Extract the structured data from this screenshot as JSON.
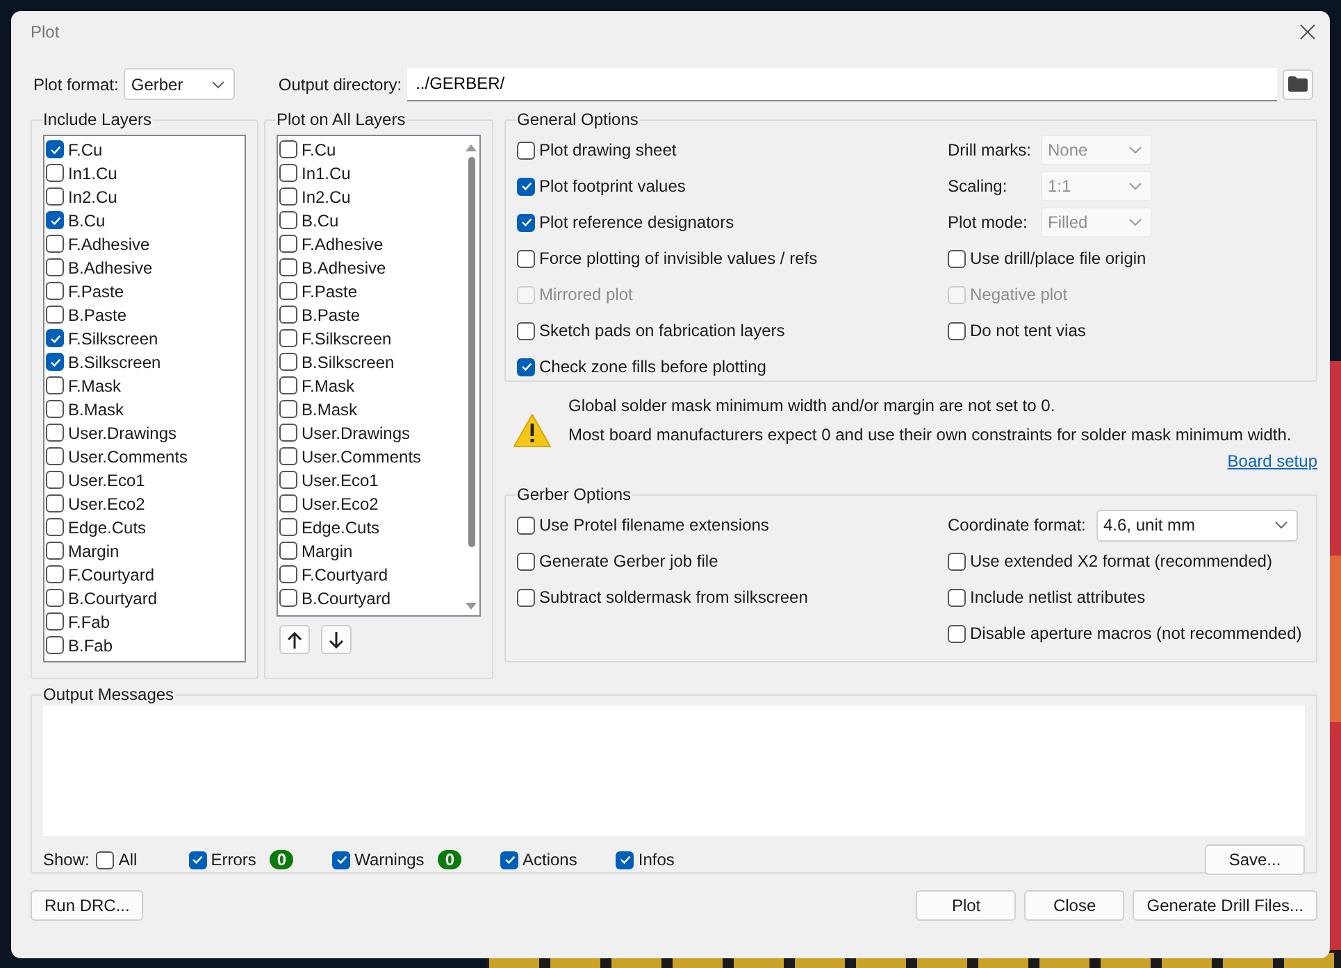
{
  "window": {
    "title": "Plot"
  },
  "plot_format": {
    "label": "Plot format:",
    "value": "Gerber"
  },
  "output_directory": {
    "label": "Output directory:",
    "value": "../GERBER/"
  },
  "include_layers": {
    "title": "Include Layers",
    "items": [
      {
        "label": "F.Cu",
        "checked": true
      },
      {
        "label": "In1.Cu",
        "checked": false
      },
      {
        "label": "In2.Cu",
        "checked": false
      },
      {
        "label": "B.Cu",
        "checked": true
      },
      {
        "label": "F.Adhesive",
        "checked": false
      },
      {
        "label": "B.Adhesive",
        "checked": false
      },
      {
        "label": "F.Paste",
        "checked": false
      },
      {
        "label": "B.Paste",
        "checked": false
      },
      {
        "label": "F.Silkscreen",
        "checked": true
      },
      {
        "label": "B.Silkscreen",
        "checked": true
      },
      {
        "label": "F.Mask",
        "checked": false
      },
      {
        "label": "B.Mask",
        "checked": false
      },
      {
        "label": "User.Drawings",
        "checked": false
      },
      {
        "label": "User.Comments",
        "checked": false
      },
      {
        "label": "User.Eco1",
        "checked": false
      },
      {
        "label": "User.Eco2",
        "checked": false
      },
      {
        "label": "Edge.Cuts",
        "checked": false
      },
      {
        "label": "Margin",
        "checked": false
      },
      {
        "label": "F.Courtyard",
        "checked": false
      },
      {
        "label": "B.Courtyard",
        "checked": false
      },
      {
        "label": "F.Fab",
        "checked": false
      },
      {
        "label": "B.Fab",
        "checked": false
      }
    ]
  },
  "plot_on_all_layers": {
    "title": "Plot on All Layers",
    "items": [
      {
        "label": "F.Cu",
        "checked": false
      },
      {
        "label": "In1.Cu",
        "checked": false
      },
      {
        "label": "In2.Cu",
        "checked": false
      },
      {
        "label": "B.Cu",
        "checked": false
      },
      {
        "label": "F.Adhesive",
        "checked": false
      },
      {
        "label": "B.Adhesive",
        "checked": false
      },
      {
        "label": "F.Paste",
        "checked": false
      },
      {
        "label": "B.Paste",
        "checked": false
      },
      {
        "label": "F.Silkscreen",
        "checked": false
      },
      {
        "label": "B.Silkscreen",
        "checked": false
      },
      {
        "label": "F.Mask",
        "checked": false
      },
      {
        "label": "B.Mask",
        "checked": false
      },
      {
        "label": "User.Drawings",
        "checked": false
      },
      {
        "label": "User.Comments",
        "checked": false
      },
      {
        "label": "User.Eco1",
        "checked": false
      },
      {
        "label": "User.Eco2",
        "checked": false
      },
      {
        "label": "Edge.Cuts",
        "checked": false
      },
      {
        "label": "Margin",
        "checked": false
      },
      {
        "label": "F.Courtyard",
        "checked": false
      },
      {
        "label": "B.Courtyard",
        "checked": false
      }
    ]
  },
  "general_options": {
    "title": "General Options",
    "left": [
      {
        "label": "Plot drawing sheet",
        "checked": false,
        "disabled": false
      },
      {
        "label": "Plot footprint values",
        "checked": true,
        "disabled": false
      },
      {
        "label": "Plot reference designators",
        "checked": true,
        "disabled": false
      },
      {
        "label": "Force plotting of invisible values / refs",
        "checked": false,
        "disabled": false
      },
      {
        "label": "Mirrored plot",
        "checked": false,
        "disabled": true
      },
      {
        "label": "Sketch pads on fabrication layers",
        "checked": false,
        "disabled": false
      },
      {
        "label": "Check zone fills before plotting",
        "checked": true,
        "disabled": false
      }
    ],
    "right": [
      {
        "kind": "select",
        "label": "Drill marks:",
        "value": "None",
        "disabled": true
      },
      {
        "kind": "select",
        "label": "Scaling:",
        "value": "1:1",
        "disabled": true
      },
      {
        "kind": "select",
        "label": "Plot mode:",
        "value": "Filled",
        "disabled": true
      },
      {
        "kind": "checkbox",
        "label": "Use drill/place file origin",
        "checked": false,
        "disabled": false
      },
      {
        "kind": "checkbox",
        "label": "Negative plot",
        "checked": false,
        "disabled": true
      },
      {
        "kind": "checkbox",
        "label": "Do not tent vias",
        "checked": false,
        "disabled": false
      }
    ]
  },
  "warning": {
    "lines": [
      "Global solder mask minimum width and/or margin are not set to 0.",
      "Most board manufacturers expect 0 and use their own constraints for solder mask minimum width."
    ],
    "link": "Board setup"
  },
  "gerber_options": {
    "title": "Gerber Options",
    "left": [
      {
        "label": "Use Protel filename extensions",
        "checked": false
      },
      {
        "label": "Generate Gerber job file",
        "checked": false
      },
      {
        "label": "Subtract soldermask from silkscreen",
        "checked": false
      }
    ],
    "right": [
      {
        "kind": "select",
        "label": "Coordinate format:",
        "value": "4.6, unit mm"
      },
      {
        "kind": "checkbox",
        "label": "Use extended X2 format (recommended)",
        "checked": false
      },
      {
        "kind": "checkbox",
        "label": "Include netlist attributes",
        "checked": false
      },
      {
        "kind": "checkbox",
        "label": "Disable aperture macros (not recommended)",
        "checked": false
      }
    ]
  },
  "output_messages": {
    "title": "Output Messages",
    "show_label": "Show:",
    "filters": [
      {
        "label": "All",
        "checked": false
      },
      {
        "label": "Errors",
        "checked": true,
        "count": "0"
      },
      {
        "label": "Warnings",
        "checked": true,
        "count": "0"
      },
      {
        "label": "Actions",
        "checked": true
      },
      {
        "label": "Infos",
        "checked": true
      }
    ],
    "save_button": "Save..."
  },
  "buttons": {
    "left": [
      "Run DRC..."
    ],
    "right": [
      "Plot",
      "Close",
      "Generate Drill Files..."
    ]
  }
}
